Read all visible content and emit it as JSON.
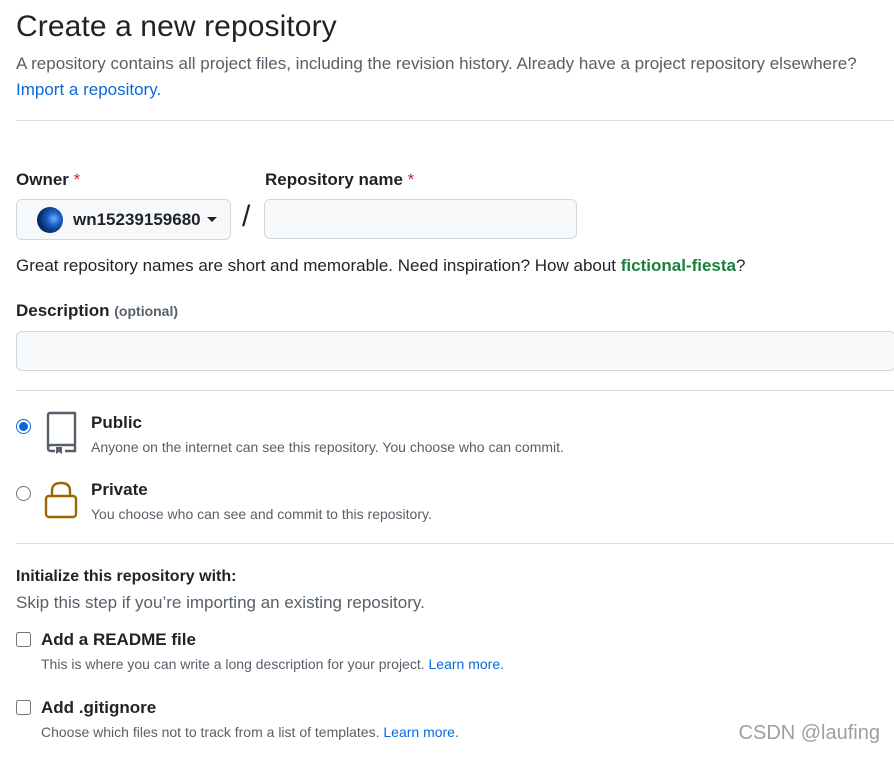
{
  "header": {
    "title": "Create a new repository",
    "subtitle": "A repository contains all project files, including the revision history. Already have a project repository elsewhere?",
    "import_link": "Import a repository."
  },
  "owner": {
    "label": "Owner",
    "required_mark": "*",
    "value": "wn15239159680"
  },
  "repo_name": {
    "label": "Repository name",
    "required_mark": "*",
    "value": "",
    "separator": "/"
  },
  "name_hint": {
    "prefix": "Great repository names are short and memorable. Need inspiration? How about ",
    "suggestion": "fictional-fiesta",
    "suffix": "?"
  },
  "description": {
    "label": "Description",
    "optional": "(optional)",
    "value": ""
  },
  "visibility": {
    "selected": "public",
    "public": {
      "title": "Public",
      "desc": "Anyone on the internet can see this repository. You choose who can commit."
    },
    "private": {
      "title": "Private",
      "desc": "You choose who can see and commit to this repository."
    }
  },
  "init": {
    "title": "Initialize this repository with:",
    "desc": "Skip this step if you’re importing an existing repository.",
    "readme": {
      "title": "Add a README file",
      "desc": "This is where you can write a long description for your project.",
      "link": "Learn more."
    },
    "gitignore": {
      "title": "Add .gitignore",
      "desc": "Choose which files not to track from a list of templates.",
      "link": "Learn more."
    }
  },
  "watermark": "CSDN @laufing",
  "colors": {
    "link": "#0969da",
    "suggestion": "#1a7f37",
    "required": "#cf222e",
    "lock_icon": "#9a6700",
    "repo_icon": "#57606a"
  }
}
